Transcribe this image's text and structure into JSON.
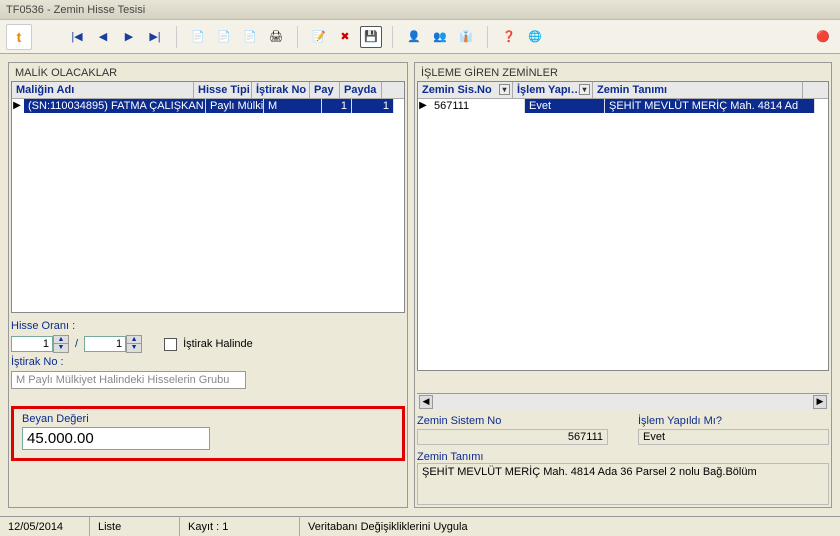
{
  "window": {
    "title": "TF0536 - Zemin Hisse Tesisi"
  },
  "toolbar": {
    "icons": {
      "app": "t",
      "nav_first": "|◀",
      "nav_prev": "◀",
      "nav_next": "▶",
      "nav_last": "▶|",
      "doc1": "📄",
      "doc2": "📄",
      "doc3": "📄",
      "print": "🖨",
      "edit1": "📝",
      "cancel": "✖",
      "save": "💾",
      "tool1": "👤",
      "tool2": "👥",
      "tool3": "👔",
      "help": "❓",
      "globe": "🌐",
      "close": "🔴"
    }
  },
  "left_panel": {
    "title": "MALİK OLACAKLAR",
    "columns": [
      "Maliğin Adı",
      "Hisse Tipi",
      "İştirak No",
      "Pay",
      "Payda"
    ],
    "row": {
      "ad": "(SN:110034895) FATMA ÇALIŞKAN :",
      "hisse_tipi": "Paylı Mülkiye",
      "istirak_no": "M",
      "pay": "1",
      "payda": "1"
    },
    "hisse_orani_label": "Hisse Oranı :",
    "hisse_a": "1",
    "hisse_b": "1",
    "istirak_halinde_label": "İştirak Halinde",
    "istirak_no_label": "İştirak No :",
    "istirak_no_value": "M Paylı Mülkiyet Halindeki Hisselerin Grubu",
    "beyan_label": "Beyan Değeri",
    "beyan_value": "45.000.00"
  },
  "right_panel": {
    "title": "İŞLEME GİREN ZEMİNLER",
    "columns": [
      "Zemin Sis.No",
      "İşlem Yapı…",
      "Zemin Tanımı"
    ],
    "row": {
      "sisno": "567111",
      "islem": "Evet",
      "tanim": "ŞEHİT MEVLÜT MERİÇ Mah. 4814 Ad"
    },
    "fields": {
      "zemin_sisno_label": "Zemin Sistem No",
      "zemin_sisno_value": "567111",
      "islem_label": "İşlem Yapıldı Mı?",
      "islem_value": "Evet",
      "tanim_label": "Zemin Tanımı",
      "tanim_value": "ŞEHİT MEVLÜT MERİÇ Mah. 4814 Ada 36 Parsel 2 nolu Bağ.Bölüm"
    }
  },
  "statusbar": {
    "date": "12/05/2014",
    "liste": "Liste",
    "kayit": "Kayıt : 1",
    "msg": "Veritabanı Değişikliklerini Uygula"
  }
}
